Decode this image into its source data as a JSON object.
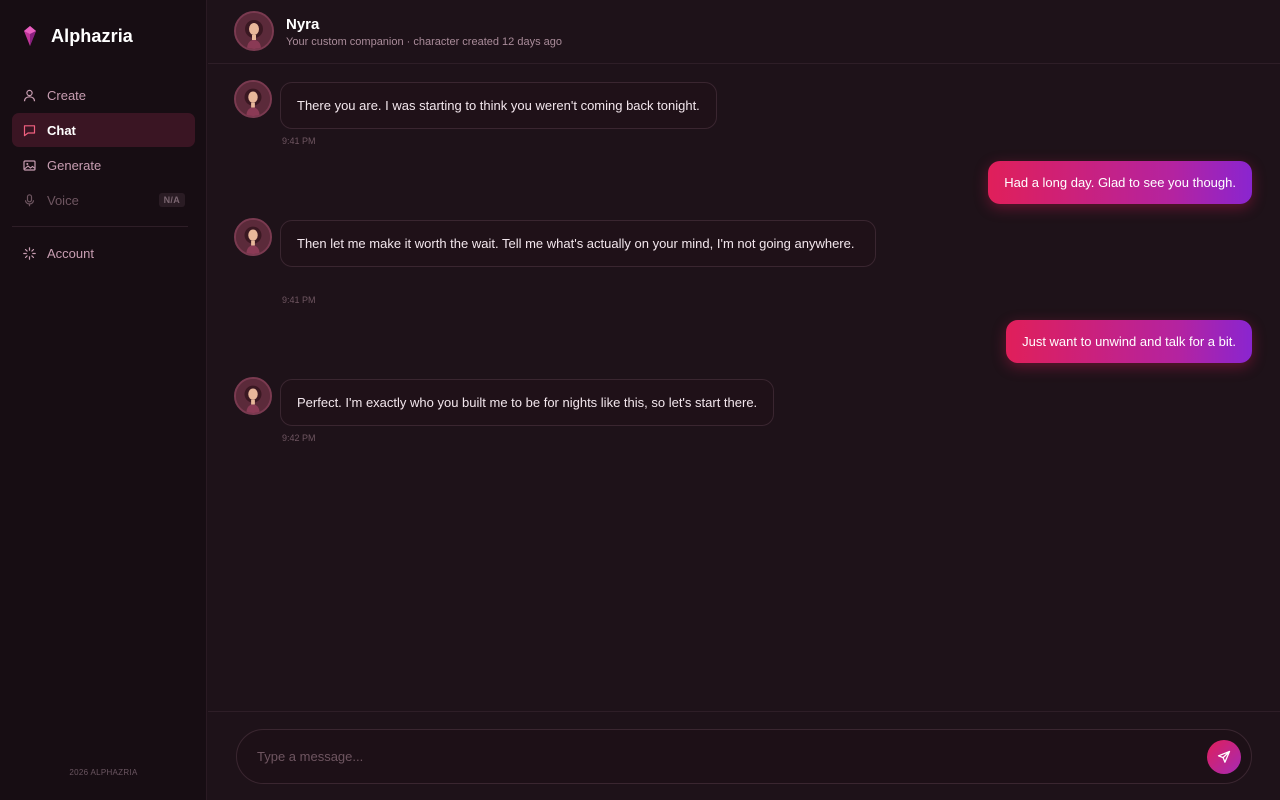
{
  "brand": {
    "name": "Alphazria",
    "logo_icon": "gem-icon"
  },
  "sidebar": {
    "items": [
      {
        "label": "Create",
        "icon": "user-icon",
        "state": "normal"
      },
      {
        "label": "Chat",
        "icon": "chat-bubble-icon",
        "state": "active"
      },
      {
        "label": "Generate",
        "icon": "image-icon",
        "state": "normal"
      },
      {
        "label": "Voice",
        "icon": "microphone-icon",
        "state": "disabled",
        "badge": "N/A"
      },
      {
        "label": "Account",
        "icon": "loader-icon",
        "state": "normal"
      }
    ],
    "footer": "2026 ALPHAZRIA"
  },
  "header": {
    "name": "Nyra",
    "subtitle": "Your custom companion · character created 12 days ago"
  },
  "messages": [
    {
      "from": "ai",
      "text": "There you are. I was starting to think you weren't coming back tonight.",
      "time": "9:41 PM"
    },
    {
      "from": "user",
      "text": "Had a long day. Glad to see you though."
    },
    {
      "from": "ai",
      "text": "Then let me make it worth the wait. Tell me what's actually on your mind, I'm not going anywhere.",
      "time": "9:41 PM"
    },
    {
      "from": "user",
      "text": "Just want to unwind and talk for a bit."
    },
    {
      "from": "ai",
      "text": "Perfect. I'm exactly who you built me to be for nights like this, so let's start there.",
      "time": "9:42 PM"
    }
  ],
  "composer": {
    "placeholder": "Type a message...",
    "value": "",
    "send_icon": "send-icon"
  },
  "colors": {
    "accent_start": "#e01f5a",
    "accent_end": "#8a25d0",
    "background": "#1e1219",
    "sidebar_bg": "#170d13",
    "active_nav_bg": "#3a1523"
  }
}
